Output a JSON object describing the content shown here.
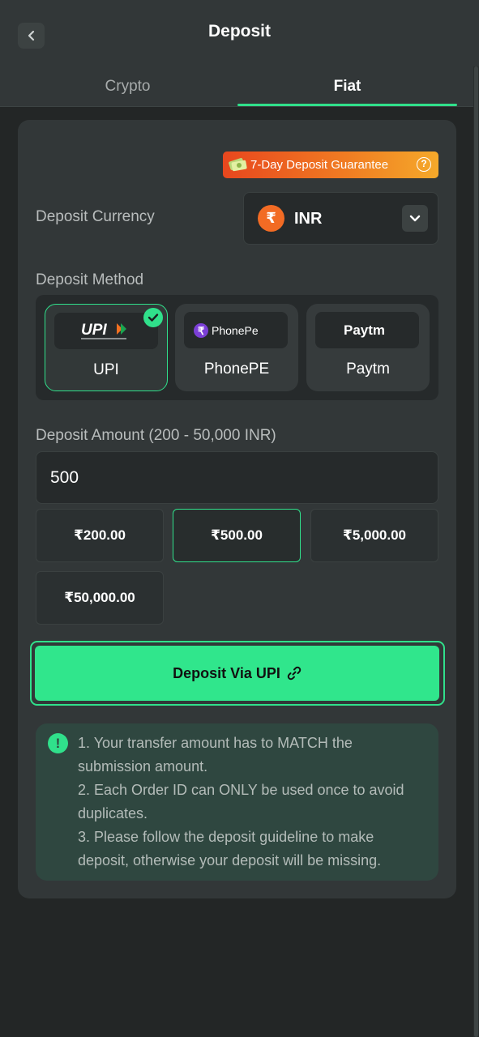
{
  "header": {
    "title": "Deposit"
  },
  "tabs": [
    {
      "label": "Crypto",
      "active": false
    },
    {
      "label": "Fiat",
      "active": true
    }
  ],
  "guarantee": {
    "label": "7-Day Deposit Guarantee"
  },
  "currency": {
    "label": "Deposit Currency",
    "symbol": "₹",
    "code": "INR"
  },
  "methods": {
    "label": "Deposit Method",
    "items": [
      {
        "name": "UPI",
        "logo_text": "UPI",
        "selected": true
      },
      {
        "name": "PhonePE",
        "logo_text": "PhonePe",
        "selected": false
      },
      {
        "name": "Paytm",
        "logo_text": "Paytm",
        "selected": false
      }
    ]
  },
  "amount": {
    "label": "Deposit Amount (200 - 50,000 INR)",
    "value": "500",
    "presets": [
      "₹200.00",
      "₹500.00",
      "₹5,000.00",
      "₹50,000.00"
    ],
    "selected_preset": "₹500.00"
  },
  "deposit_button": {
    "label": "Deposit Via UPI"
  },
  "notice": {
    "lines": [
      "1. Your transfer amount has to MATCH the submission amount.",
      "2. Each Order ID can ONLY be used once to avoid duplicates.",
      "3. Please follow the deposit guideline to make deposit, otherwise your deposit will be missing."
    ]
  },
  "colors": {
    "accent": "#30e08b",
    "background": "#232626",
    "card": "#323738",
    "rupee_badge": "#f26b24",
    "phonepe": "#7b3fd6"
  }
}
